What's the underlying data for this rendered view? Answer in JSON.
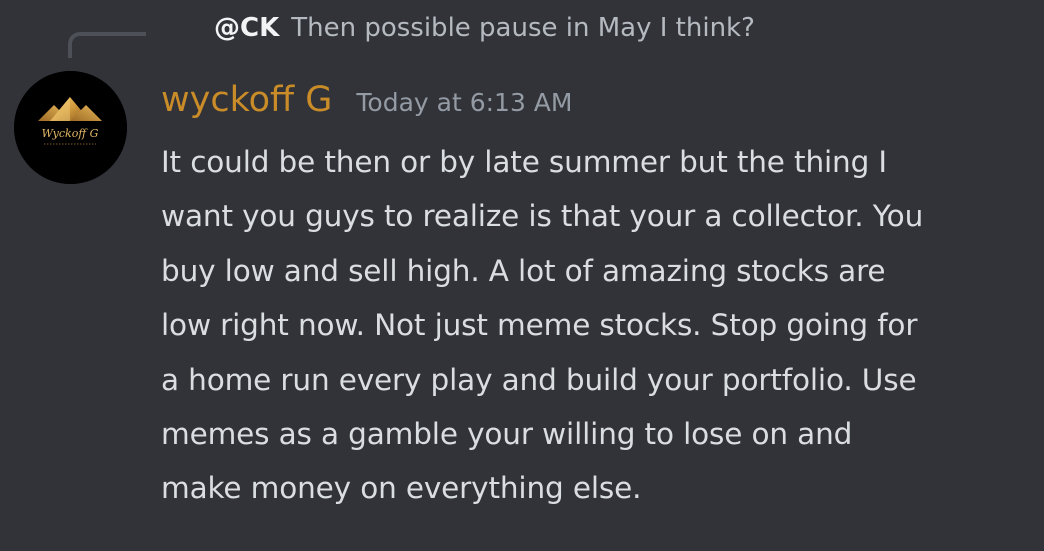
{
  "reply": {
    "author": "@CK",
    "text": "Then possible pause in May I think?"
  },
  "message": {
    "author": "wyckoff G",
    "timestamp": "Today at 6:13 AM",
    "lines": [
      "It could be then or by late summer but the thing I",
      "want you guys to realize is that your a collector. You",
      "buy low and sell high. A lot of amazing stocks are",
      "low right now. Not just meme stocks. Stop going for",
      "a home run every play and build your portfolio. Use",
      "memes as a gamble your willing to lose on and",
      "make money on everything else."
    ],
    "author_color": "#c98c28"
  },
  "avatar": {
    "logo_text": "Wyckoff G",
    "icon": "gold-pyramid-logo"
  },
  "colors": {
    "background": "#313338",
    "text": "#dbdee1",
    "muted": "#949ba4",
    "accent": "#c98c28"
  }
}
